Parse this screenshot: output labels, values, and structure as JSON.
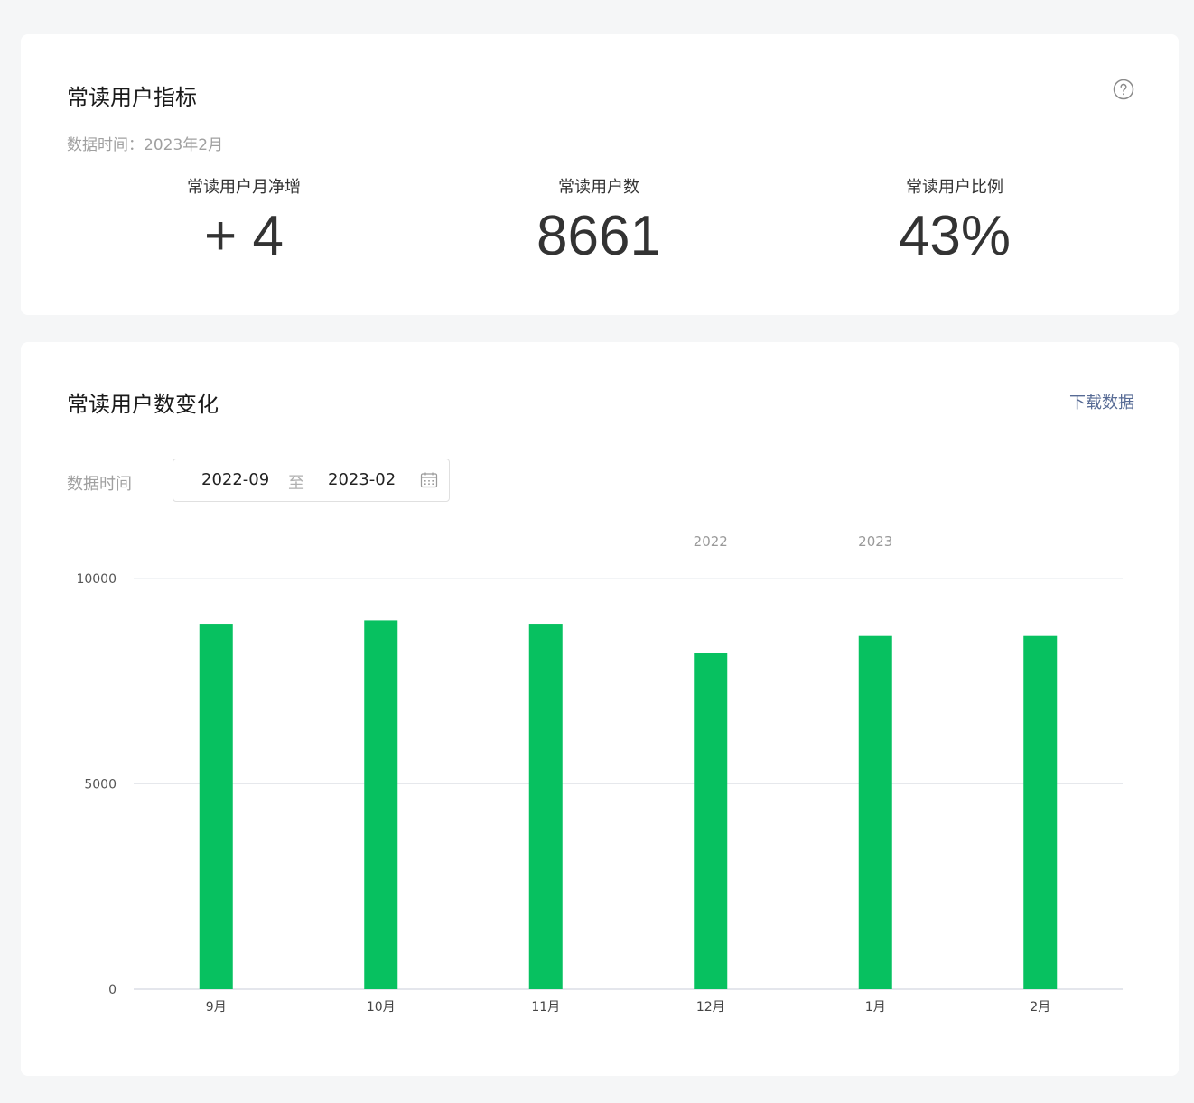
{
  "indicators": {
    "title": "常读用户指标",
    "help_icon": "question-circle-icon",
    "data_time": "数据时间：2023年2月",
    "metrics": [
      {
        "label": "常读用户月净增",
        "value": "+ 4"
      },
      {
        "label": "常读用户数",
        "value": "8661"
      },
      {
        "label": "常读用户比例",
        "value": "43%"
      }
    ]
  },
  "trend": {
    "title": "常读用户数变化",
    "download_label": "下载数据",
    "filter_label": "数据时间",
    "date_start": "2022-09",
    "date_separator": "至",
    "date_end": "2023-02",
    "calendar_icon": "calendar-icon"
  },
  "colors": {
    "bar": "#07c160",
    "link": "#576b95"
  },
  "chart_data": {
    "type": "bar",
    "categories": [
      "9月",
      "10月",
      "11月",
      "12月",
      "1月",
      "2月"
    ],
    "year_labels": [
      {
        "category": "12月",
        "text": "2022"
      },
      {
        "category": "1月",
        "text": "2023"
      }
    ],
    "values": [
      8900,
      8980,
      8900,
      8190,
      8600,
      8600
    ],
    "yticks": [
      0,
      5000,
      10000
    ],
    "ylim": [
      0,
      10000
    ],
    "grid": true
  }
}
